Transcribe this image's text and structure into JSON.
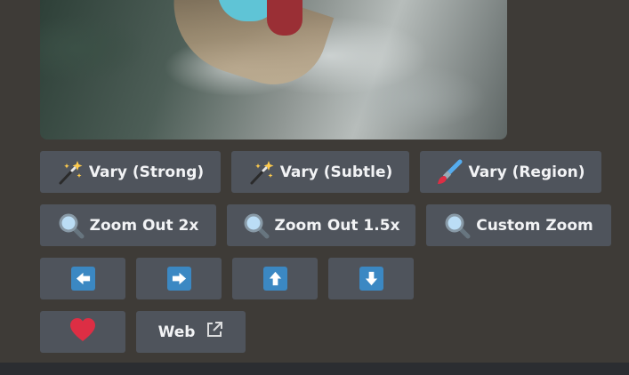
{
  "image": {
    "icon": "generated-image"
  },
  "row1": [
    {
      "label": "Vary (Strong)",
      "icon": "magic-wand-icon"
    },
    {
      "label": "Vary (Subtle)",
      "icon": "magic-wand-icon"
    },
    {
      "label": "Vary (Region)",
      "icon": "paintbrush-icon"
    }
  ],
  "row2": [
    {
      "label": "Zoom Out 2x",
      "icon": "magnifier-icon"
    },
    {
      "label": "Zoom Out 1.5x",
      "icon": "magnifier-icon"
    },
    {
      "label": "Custom Zoom",
      "icon": "magnifier-icon"
    }
  ],
  "row3": [
    {
      "icon": "arrow-left-icon"
    },
    {
      "icon": "arrow-right-icon"
    },
    {
      "icon": "arrow-up-icon"
    },
    {
      "icon": "arrow-down-icon"
    }
  ],
  "row4": {
    "favorite_icon": "heart-icon",
    "web_label": "Web",
    "web_icon": "external-link-icon"
  },
  "colors": {
    "background": "#3e3b37",
    "button": "#4f545c",
    "arrow_blue": "#3b88c3",
    "heart_red": "#dd2e44",
    "footer": "#2b2d31"
  }
}
